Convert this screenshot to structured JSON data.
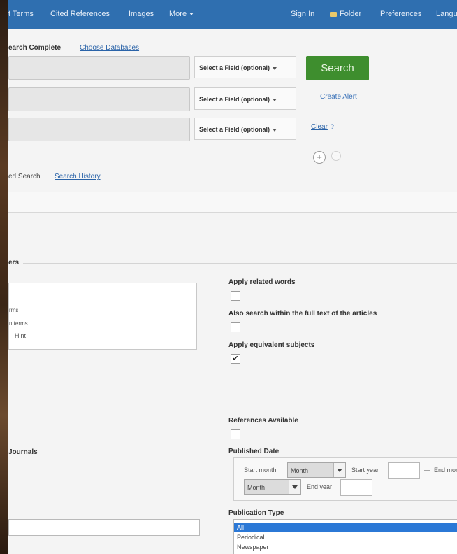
{
  "topnav": {
    "items": [
      "t Terms",
      "Cited References",
      "Images",
      "More"
    ],
    "sign_in": "Sign In",
    "folder": "Folder",
    "preferences": "Preferences",
    "language": "Langu"
  },
  "subheader": {
    "label": "earch Complete",
    "choose_db": "Choose Databases"
  },
  "search": {
    "field_select": "Select a Field (optional)",
    "search_button": "Search",
    "create_alert": "Create Alert",
    "clear": "Clear",
    "help": "?"
  },
  "search_tabs": {
    "advanced": "ed Search",
    "history": "Search History"
  },
  "modes_section": {
    "title": "ers",
    "modes": [
      "rms",
      "n terms",
      "Hint"
    ],
    "options": [
      {
        "label": "Apply related words",
        "checked": false
      },
      {
        "label": "Also search within the full text of the articles",
        "checked": false
      },
      {
        "label": "Apply equivalent subjects",
        "checked": true
      }
    ]
  },
  "limit_section": {
    "left_label": "Journals",
    "references_label": "References Available",
    "published_date": {
      "label": "Published Date",
      "start_month_label": "Start month",
      "start_month_value": "Month",
      "start_year_label": "Start year",
      "end_month_label": "End mon",
      "end_month_value": "Month",
      "end_year_label": "End year",
      "separator": "—"
    },
    "publication_type": {
      "label": "Publication Type",
      "options": [
        "All",
        "Periodical",
        "Newspaper"
      ],
      "selected": "All"
    }
  },
  "colors": {
    "topbar": "#2f6fb0",
    "search_button": "#3e8e2e",
    "link": "#2a63a8",
    "selected_option": "#2b78d6"
  }
}
